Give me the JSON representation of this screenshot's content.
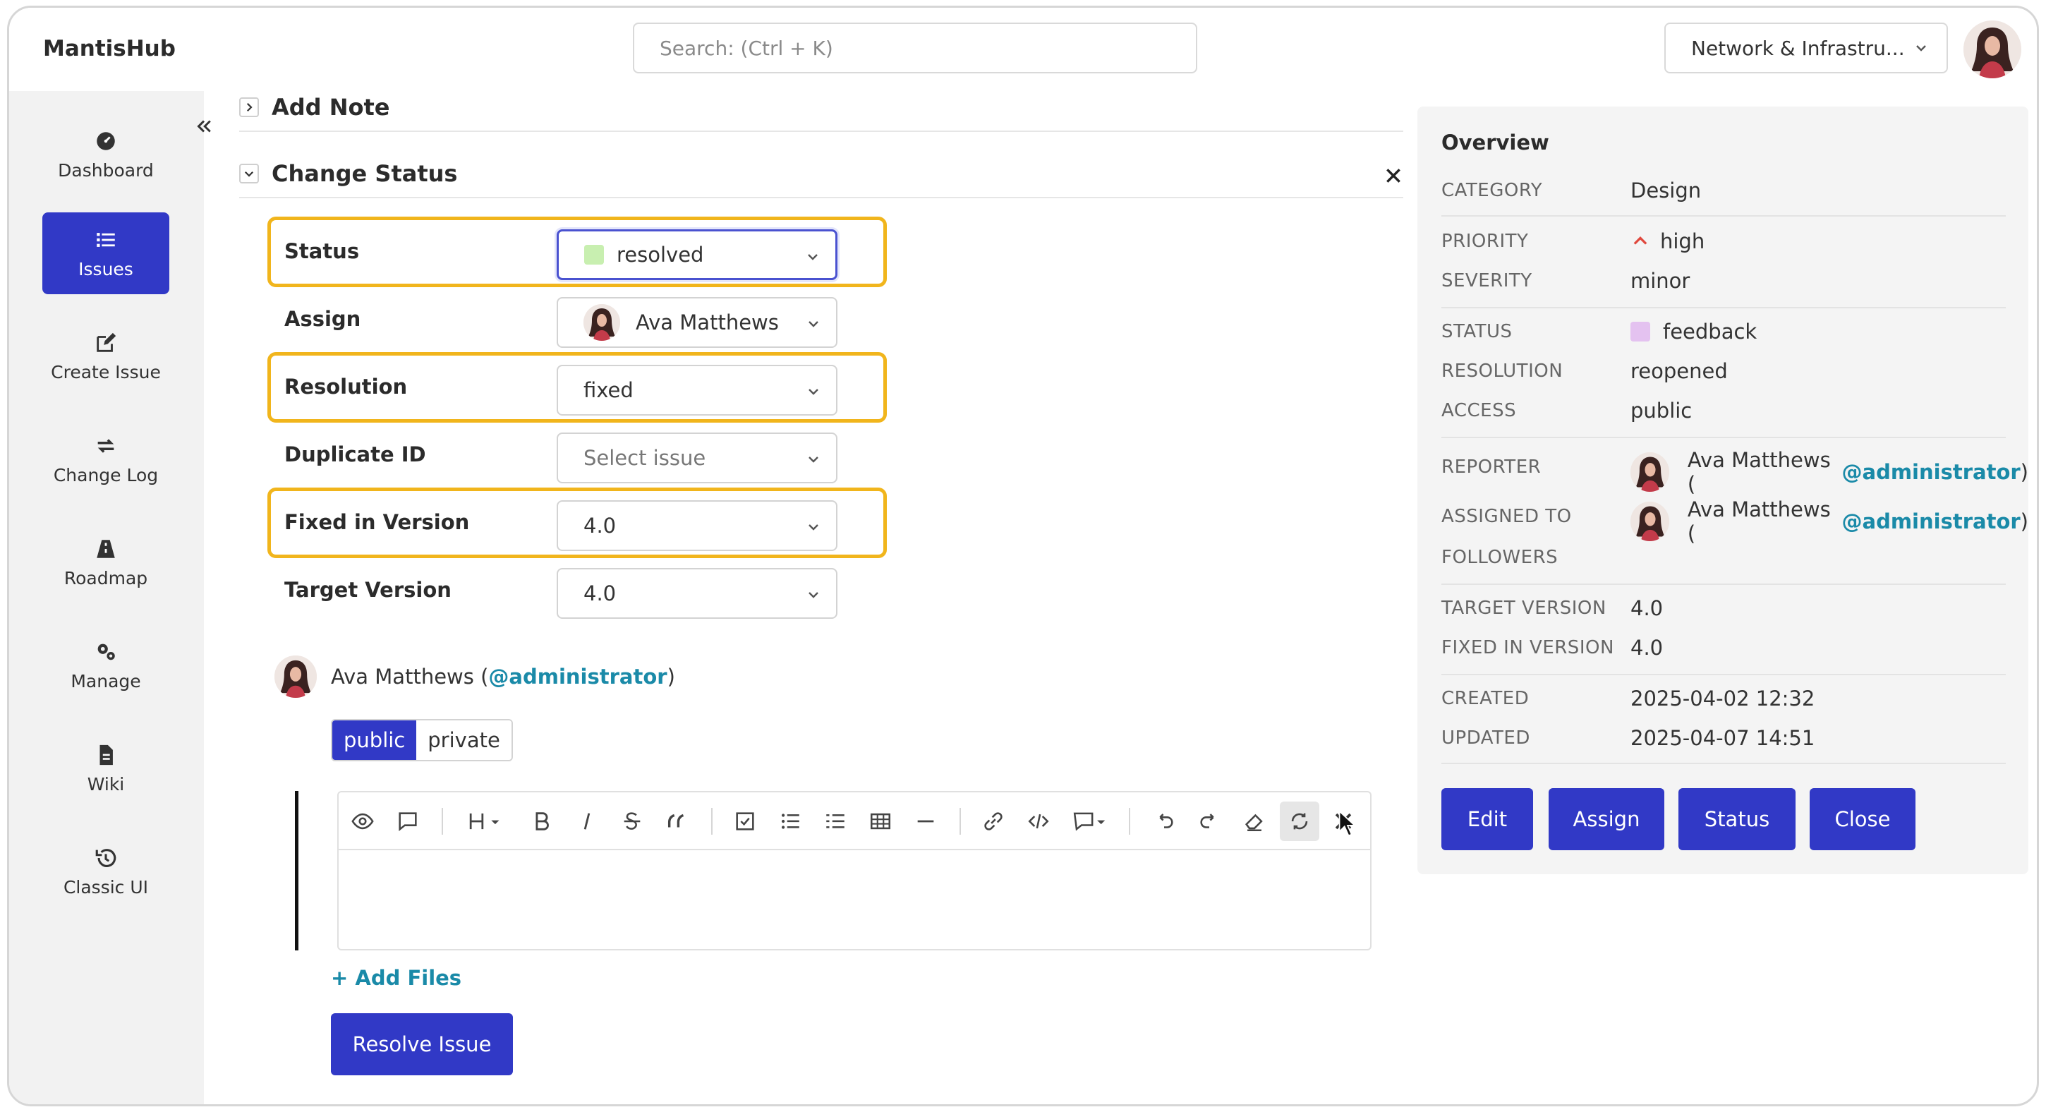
{
  "app": {
    "brand": "MantisHub"
  },
  "search": {
    "placeholder": "Search: (Ctrl + K)"
  },
  "project_selector": {
    "value": "Network & Infrastru..."
  },
  "sidebar": {
    "items": [
      {
        "label": "Dashboard",
        "icon": "dashboard-icon",
        "active": false
      },
      {
        "label": "Issues",
        "icon": "list-icon",
        "active": true
      },
      {
        "label": "Create Issue",
        "icon": "edit-icon",
        "active": false
      },
      {
        "label": "Change Log",
        "icon": "changelog-icon",
        "active": false
      },
      {
        "label": "Roadmap",
        "icon": "road-icon",
        "active": false
      },
      {
        "label": "Manage",
        "icon": "gears-icon",
        "active": false
      },
      {
        "label": "Wiki",
        "icon": "file-icon",
        "active": false
      },
      {
        "label": "Classic UI",
        "icon": "history-icon",
        "active": false
      }
    ]
  },
  "add_note": {
    "title": "Add Note"
  },
  "change_status": {
    "title": "Change Status",
    "fields": {
      "status": {
        "label": "Status",
        "value": "resolved",
        "swatch": "#c8efb0"
      },
      "assign": {
        "label": "Assign",
        "value": "Ava Matthews"
      },
      "resolution": {
        "label": "Resolution",
        "value": "fixed"
      },
      "duplicate": {
        "label": "Duplicate ID",
        "placeholder": "Select issue"
      },
      "fixed_in": {
        "label": "Fixed in Version",
        "value": "4.0"
      },
      "target": {
        "label": "Target Version",
        "value": "4.0"
      }
    },
    "note_author": {
      "name": "Ava Matthews (",
      "handle": "@administrator",
      "close": ")"
    },
    "visibility": {
      "public": "public",
      "private": "private"
    },
    "add_files": "+ Add Files",
    "submit": "Resolve Issue"
  },
  "overview": {
    "title": "Overview",
    "category": {
      "k": "CATEGORY",
      "v": "Design"
    },
    "priority": {
      "k": "PRIORITY",
      "v": "high"
    },
    "severity": {
      "k": "SEVERITY",
      "v": "minor"
    },
    "status": {
      "k": "STATUS",
      "v": "feedback",
      "swatch": "#e4c2f0"
    },
    "resolution": {
      "k": "RESOLUTION",
      "v": "reopened"
    },
    "access": {
      "k": "ACCESS",
      "v": "public"
    },
    "reporter": {
      "k": "REPORTER",
      "name": "Ava Matthews (",
      "handle": "@administrator",
      "close": ")"
    },
    "assigned": {
      "k": "ASSIGNED TO",
      "name": "Ava Matthews (",
      "handle": "@administrator",
      "close": ")"
    },
    "followers": {
      "k": "FOLLOWERS"
    },
    "target_version": {
      "k": "TARGET VERSION",
      "v": "4.0"
    },
    "fixed_version": {
      "k": "FIXED IN VERSION",
      "v": "4.0"
    },
    "created": {
      "k": "CREATED",
      "v": "2025-04-02 12:32"
    },
    "updated": {
      "k": "UPDATED",
      "v": "2025-04-07 14:51"
    },
    "buttons": {
      "edit": "Edit",
      "assign": "Assign",
      "status": "Status",
      "close": "Close"
    }
  },
  "colors": {
    "accent": "#3139c6",
    "highlight": "#f1b51c",
    "link": "#1a8aa8",
    "priority_high": "#e0483d"
  }
}
